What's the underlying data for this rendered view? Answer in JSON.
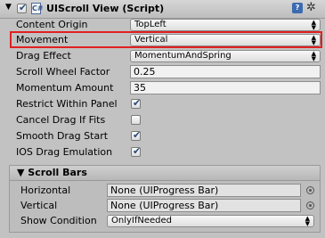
{
  "header": {
    "fold_glyph": "▼",
    "script_icon_letter": "C#",
    "title": "UIScroll View (Script)",
    "enabled": true,
    "help_glyph": "?",
    "gear_glyph": "✲"
  },
  "properties": {
    "content_origin": {
      "label": "Content Origin",
      "value": "TopLeft"
    },
    "movement": {
      "label": "Movement",
      "value": "Vertical"
    },
    "drag_effect": {
      "label": "Drag Effect",
      "value": "MomentumAndSpring"
    },
    "scroll_wheel_factor": {
      "label": "Scroll Wheel Factor",
      "value": "0.25"
    },
    "momentum_amount": {
      "label": "Momentum Amount",
      "value": "35"
    },
    "restrict_within_panel": {
      "label": "Restrict Within Panel",
      "checked": true
    },
    "cancel_drag_if_fits": {
      "label": "Cancel Drag If Fits",
      "checked": false
    },
    "smooth_drag_start": {
      "label": "Smooth Drag Start",
      "checked": true
    },
    "ios_drag_emulation": {
      "label": "IOS Drag Emulation",
      "checked": true
    }
  },
  "scroll_bars": {
    "title": "▼ Scroll Bars",
    "horizontal": {
      "label": "Horizontal",
      "value": "None (UIProgress Bar)"
    },
    "vertical": {
      "label": "Vertical",
      "value": "None (UIProgress Bar)"
    },
    "show_condition": {
      "label": "Show Condition",
      "value": "OnlyIfNeeded"
    }
  },
  "glyphs": {
    "check": "✔",
    "popup_arrows": "▲▼"
  },
  "colors": {
    "highlight": "#e02020",
    "check": "#2a4a78",
    "help_icon": "#3b6ab0"
  }
}
